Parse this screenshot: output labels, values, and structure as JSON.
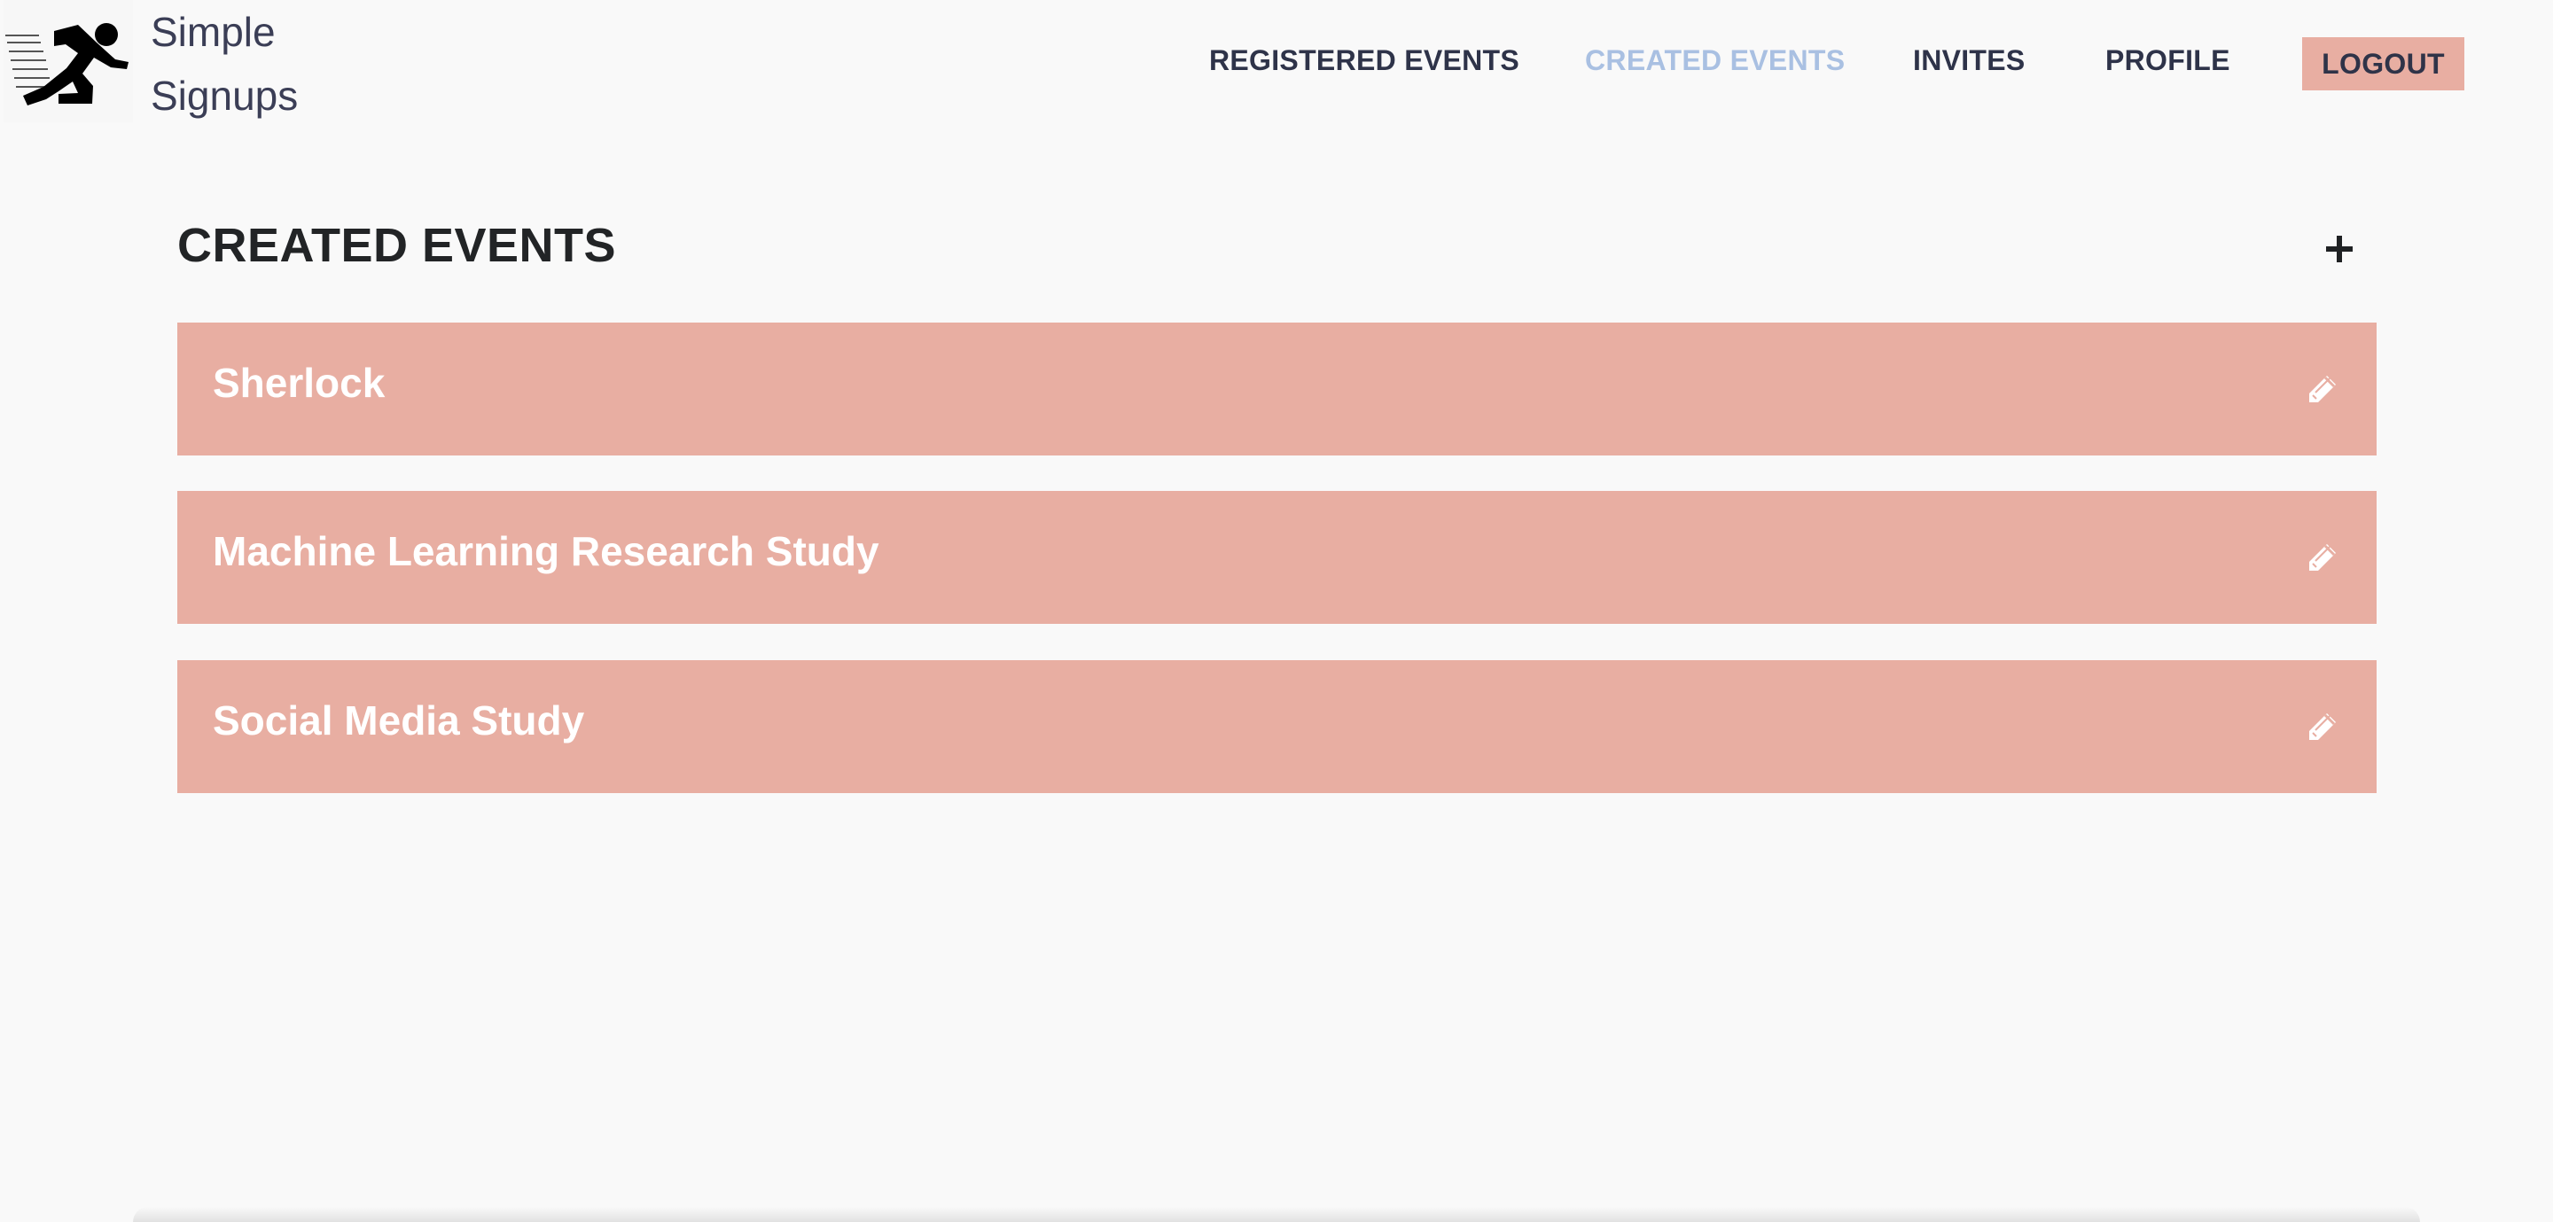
{
  "brand": {
    "line1": "Simple",
    "line2": "Signups",
    "logo_icon": "running-person-icon"
  },
  "nav": {
    "registered_events": "REGISTERED EVENTS",
    "created_events": "CREATED EVENTS",
    "invites": "INVITES",
    "profile": "PROFILE",
    "logout": "LOGOUT",
    "active_item": "created_events"
  },
  "main": {
    "title": "CREATED EVENTS",
    "add_icon": "plus-icon",
    "events": [
      {
        "title": "Sherlock",
        "edit_icon": "pencil-icon"
      },
      {
        "title": "Machine Learning Research Study",
        "edit_icon": "pencil-icon"
      },
      {
        "title": "Social Media Study",
        "edit_icon": "pencil-icon"
      }
    ]
  },
  "colors": {
    "background": "#f9f9f9",
    "card": "#e8aea2",
    "active_nav": "#a9c0e2",
    "nav_text": "#2e3349",
    "title_text": "#222426",
    "white": "#ffffff"
  }
}
